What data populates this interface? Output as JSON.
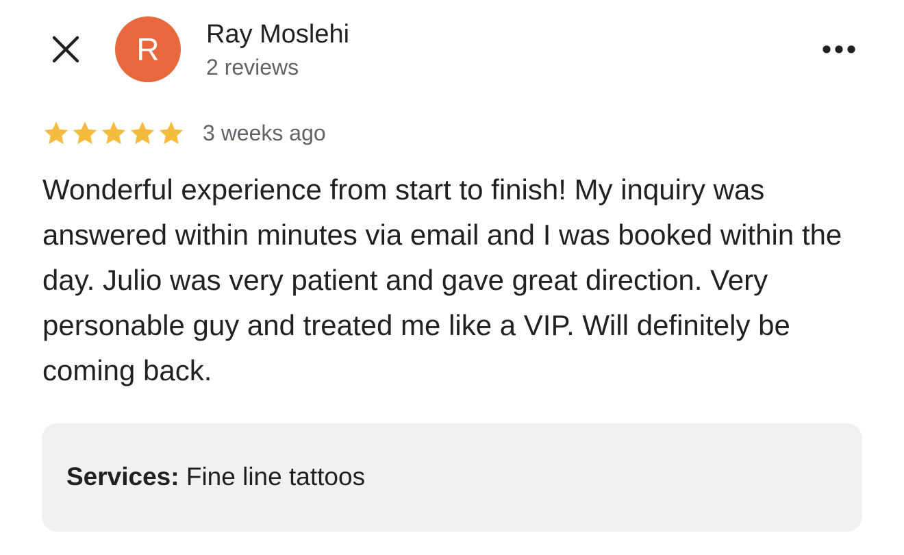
{
  "icons": {
    "close": "close-icon",
    "more": "more-horizontal-icon",
    "star": "star-icon"
  },
  "colors": {
    "avatar_background": "#e8673c",
    "star": "#f5bb3d",
    "secondary_text": "#5f6368",
    "primary_text": "#202124",
    "services_background": "#f1f1f1"
  },
  "reviewer": {
    "avatar_initial": "R",
    "name": "Ray Moslehi",
    "review_count": "2 reviews"
  },
  "review": {
    "rating": 5,
    "rating_max": 5,
    "time_ago": "3 weeks ago",
    "text": "Wonderful experience from start to finish! My inquiry was answered within minutes via email and I was booked within the day. Julio was very patient and gave great direction. Very personable guy and treated me like a VIP. Will definitely be coming back."
  },
  "services": {
    "label": "Services:",
    "value": "Fine line tattoos"
  }
}
